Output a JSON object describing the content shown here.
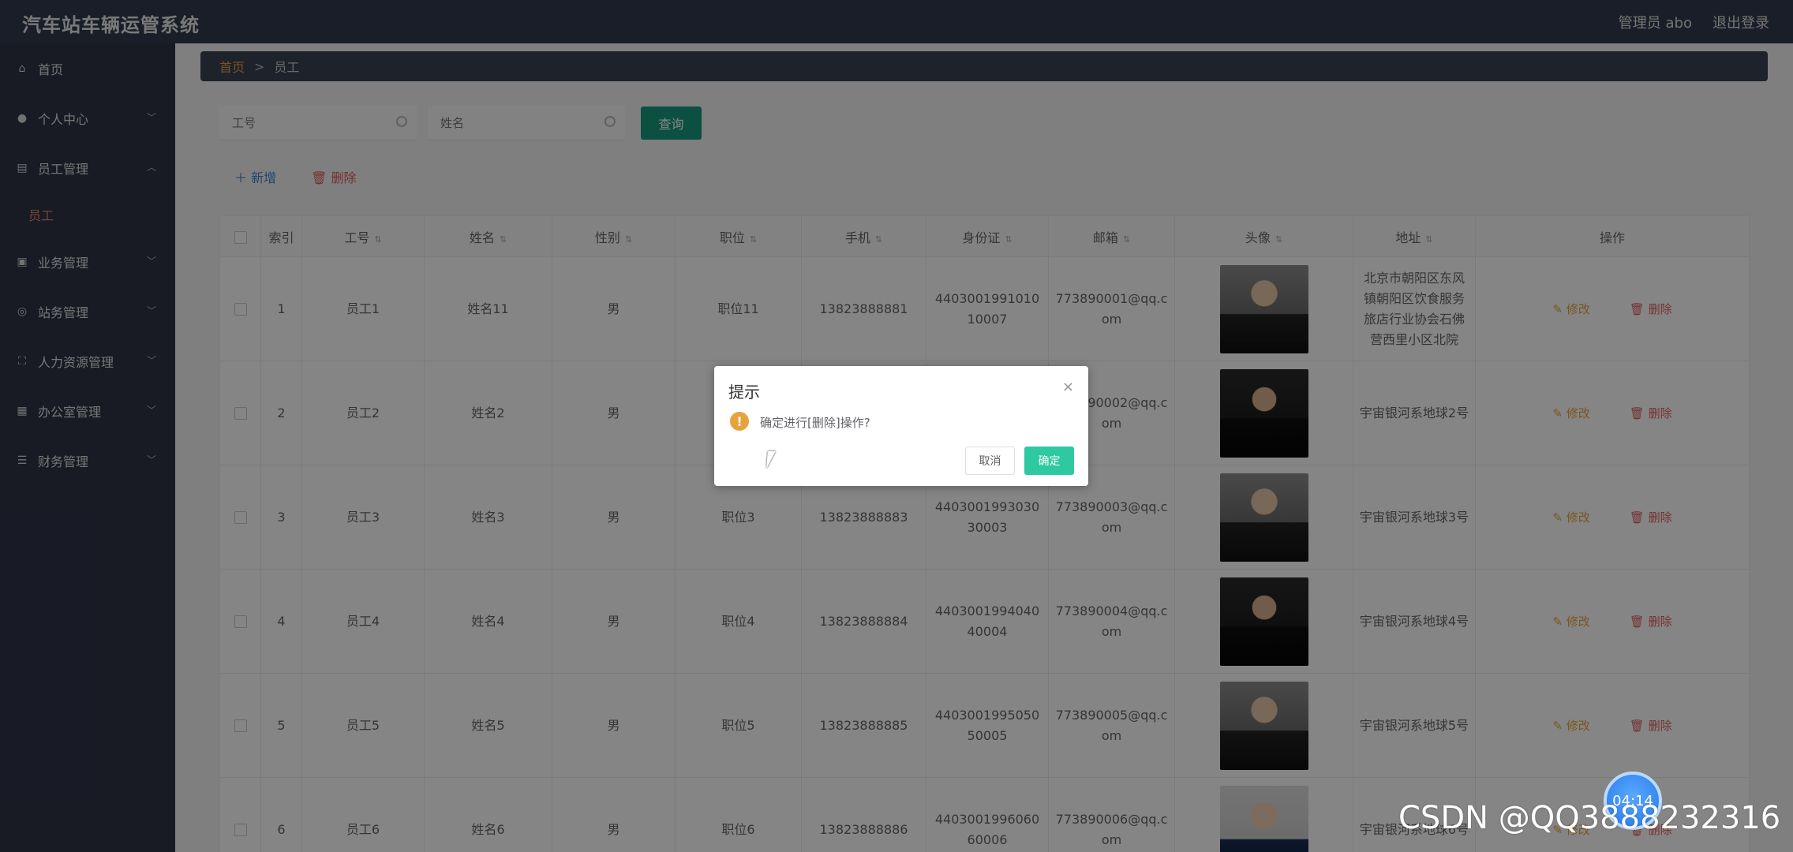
{
  "header": {
    "app_title": "汽车站车辆运管系统",
    "user_label": "管理员 abo",
    "logout_label": "退出登录"
  },
  "sidebar": {
    "items": [
      {
        "label": "首页",
        "icon": "home-icon"
      },
      {
        "label": "个人中心",
        "icon": "user-icon"
      },
      {
        "label": "员工管理",
        "icon": "clipboard-icon",
        "expanded": true,
        "sub": "员工"
      },
      {
        "label": "业务管理",
        "icon": "briefcase-icon"
      },
      {
        "label": "站务管理",
        "icon": "compass-icon"
      },
      {
        "label": "人力资源管理",
        "icon": "fullscreen-icon"
      },
      {
        "label": "办公室管理",
        "icon": "grid-icon"
      },
      {
        "label": "财务管理",
        "icon": "sliders-icon"
      }
    ]
  },
  "breadcrumb": {
    "home": "首页",
    "sep": ">",
    "current": "员工"
  },
  "search": {
    "emp_no_placeholder": "工号",
    "name_placeholder": "姓名",
    "query_label": "查询"
  },
  "actions": {
    "add_label": "＋ 新增",
    "delete_label": "🗑 删除"
  },
  "table": {
    "headers": [
      "索引",
      "工号",
      "姓名",
      "性别",
      "职位",
      "手机",
      "身份证",
      "邮箱",
      "头像",
      "地址",
      "操作"
    ],
    "edit_label": "✎ 修改",
    "delete_label": "🗑 删除",
    "rows": [
      {
        "idx": "1",
        "no": "员工1",
        "name": "姓名11",
        "gender": "男",
        "pos": "职位11",
        "phone": "13823888881",
        "id": "440300199101010007",
        "email": "773890001@qq.com",
        "addr": "北京市朝阳区东风镇朝阳区饮食服务旅店行业协会石佛营西里小区北院"
      },
      {
        "idx": "2",
        "no": "员工2",
        "name": "姓名2",
        "gender": "男",
        "pos": "",
        "phone": "",
        "id": "",
        "email": "773890002@qq.com",
        "addr": "宇宙银河系地球2号"
      },
      {
        "idx": "3",
        "no": "员工3",
        "name": "姓名3",
        "gender": "男",
        "pos": "职位3",
        "phone": "13823888883",
        "id": "440300199303030003",
        "email": "773890003@qq.com",
        "addr": "宇宙银河系地球3号"
      },
      {
        "idx": "4",
        "no": "员工4",
        "name": "姓名4",
        "gender": "男",
        "pos": "职位4",
        "phone": "13823888884",
        "id": "440300199404040004",
        "email": "773890004@qq.com",
        "addr": "宇宙银河系地球4号"
      },
      {
        "idx": "5",
        "no": "员工5",
        "name": "姓名5",
        "gender": "男",
        "pos": "职位5",
        "phone": "13823888885",
        "id": "440300199505050005",
        "email": "773890005@qq.com",
        "addr": "宇宙银河系地球5号"
      },
      {
        "idx": "6",
        "no": "员工6",
        "name": "姓名6",
        "gender": "男",
        "pos": "职位6",
        "phone": "13823888886",
        "id": "440300199606060006",
        "email": "773890006@qq.com",
        "addr": "宇宙银河系地球6号"
      }
    ]
  },
  "dialog": {
    "title": "提示",
    "message": "确定进行[删除]操作?",
    "cancel_label": "取消",
    "ok_label": "确定",
    "close_glyph": "×",
    "warn_glyph": "!"
  },
  "timer": "04:14",
  "watermark": "CSDN @QQ3888232316"
}
